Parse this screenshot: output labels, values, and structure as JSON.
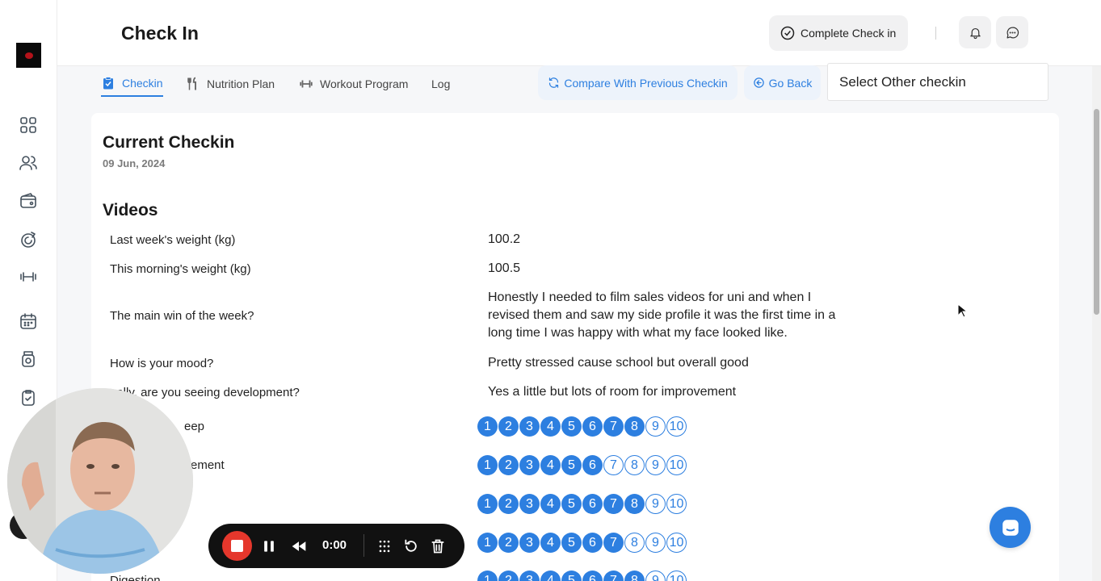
{
  "header": {
    "title": "Check In",
    "complete_label": "Complete Check in"
  },
  "tabs": [
    {
      "label": "Checkin",
      "icon": "clipboard-check-icon"
    },
    {
      "label": "Nutrition Plan",
      "icon": "fork-knife-icon"
    },
    {
      "label": "Workout Program",
      "icon": "dumbbell-icon"
    },
    {
      "label": "Log",
      "icon": ""
    }
  ],
  "actions": {
    "compare_label": "Compare With Previous Checkin",
    "go_back_label": "Go Back",
    "select_placeholder": "Select Other checkin"
  },
  "card": {
    "title": "Current Checkin",
    "date": "09 Jun, 2024",
    "section": "Videos"
  },
  "rows": [
    {
      "question": "Last week's weight (kg)",
      "answer": "100.2"
    },
    {
      "question": "This morning's weight (kg)",
      "answer": "100.5"
    },
    {
      "question": "The main win of the week?",
      "answer": "Honestly I needed to film sales videos for uni and when I revised them and saw my side profile it was the first time in a long time I was happy with what my face looked like."
    },
    {
      "question": "How is your mood?",
      "answer": "Pretty stressed cause school but overall good"
    },
    {
      "question": "ually, are you seeing development?",
      "answer": "Yes a little but lots of room for improvement"
    }
  ],
  "ratings": [
    {
      "label": "eep",
      "value": 8
    },
    {
      "label": "ement",
      "value": 6
    },
    {
      "label": "",
      "value": 8
    },
    {
      "label": "",
      "value": 7
    },
    {
      "label": "Digestion",
      "value": 8
    }
  ],
  "recorder": {
    "time": "0:00"
  },
  "colors": {
    "accent": "#2d7fe0",
    "record": "#e5372c"
  }
}
